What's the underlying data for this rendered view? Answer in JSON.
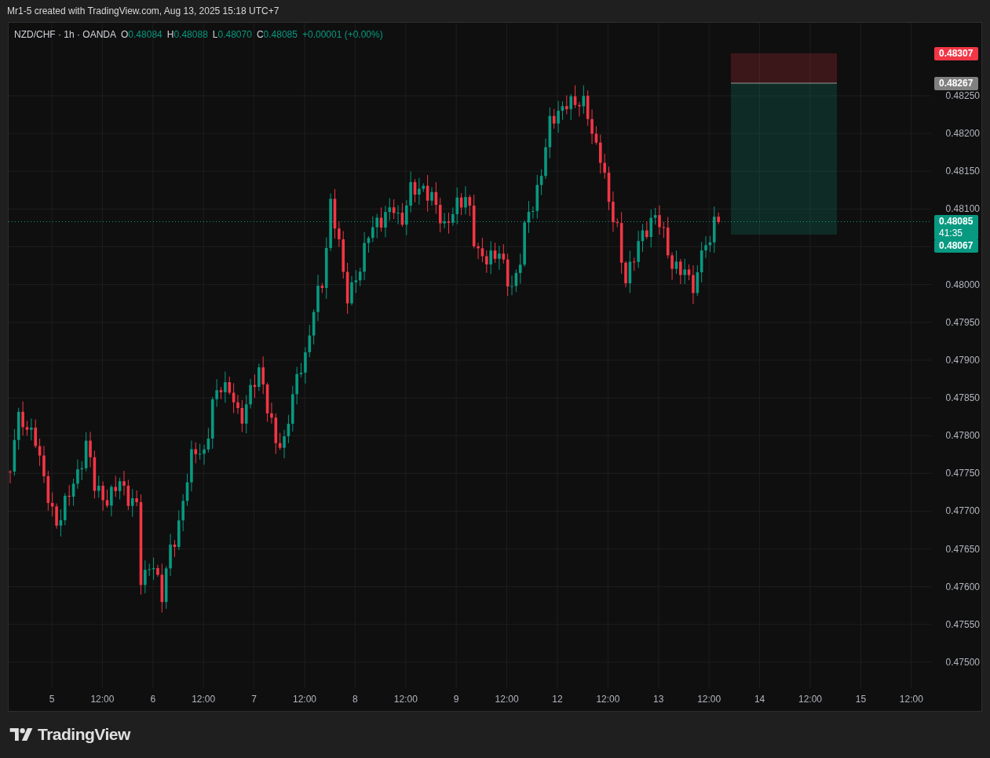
{
  "top_bar": {
    "title": "Mr1-5 created with TradingView.com, Aug 13, 2025 15:18 UTC+7"
  },
  "legend": {
    "symbol": "NZD/CHF · 1h · OANDA",
    "values": [
      {
        "label": "O",
        "value": "0.48084"
      },
      {
        "label": "H",
        "value": "0.48088"
      },
      {
        "label": "L",
        "value": "0.48070"
      },
      {
        "label": "C",
        "value": "0.48085"
      }
    ],
    "change": "+0.00001 (+0.00%)"
  },
  "price_axis": {
    "labels": [
      "0.48250",
      "0.48200",
      "0.48150",
      "0.48100",
      "0.48000",
      "0.47950",
      "0.47900",
      "0.47850",
      "0.47800",
      "0.47750",
      "0.47700",
      "0.47650",
      "0.47600",
      "0.47550",
      "0.47500"
    ]
  },
  "price_badges": [
    {
      "text": "0.48307",
      "color": "#f23645"
    },
    {
      "text": "0.48267",
      "color": "#808080"
    },
    {
      "text": "0.48085",
      "sub": "41:35",
      "color": "#089981"
    },
    {
      "text": "0.48067",
      "color": "#089981"
    }
  ],
  "time_axis": {
    "labels": [
      "5",
      "12:00",
      "6",
      "12:00",
      "7",
      "12:00",
      "8",
      "12:00",
      "9",
      "12:00",
      "12",
      "12:00",
      "13",
      "12:00",
      "14",
      "12:00",
      "15",
      "12:00"
    ]
  },
  "footer": {
    "logo": "TradingView"
  }
}
